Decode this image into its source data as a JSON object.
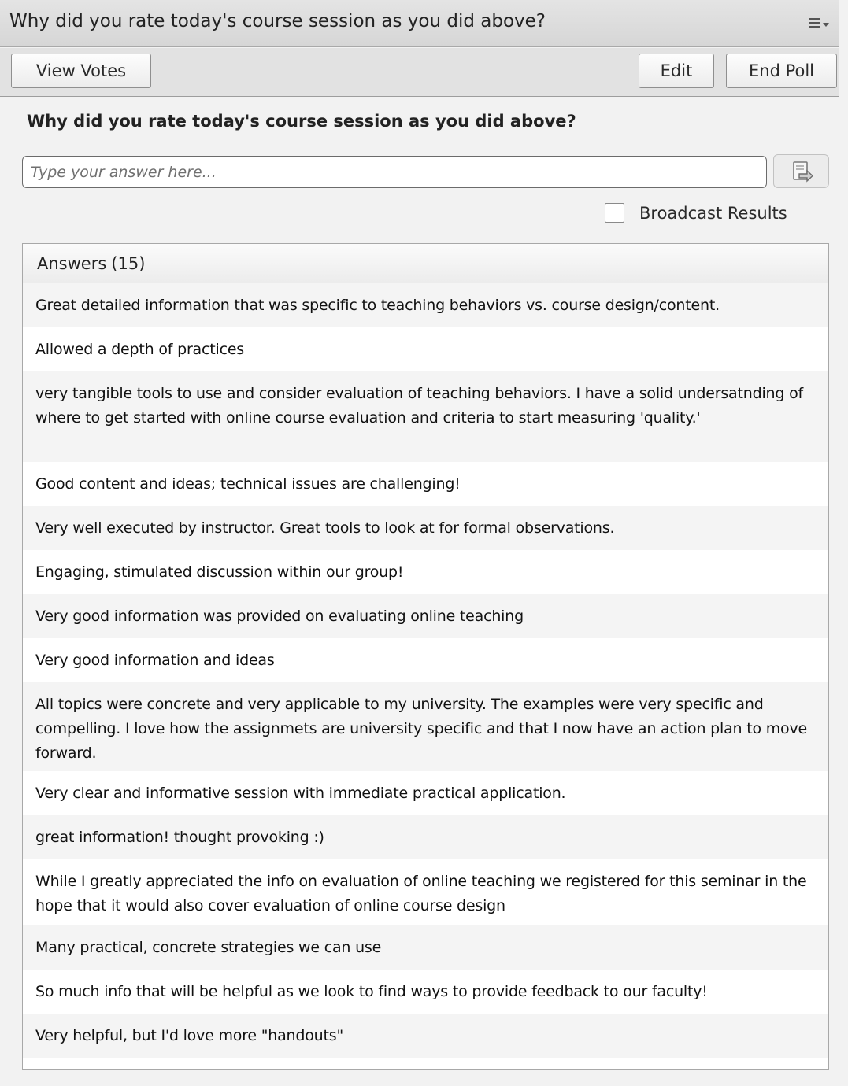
{
  "pod": {
    "title": "Why did you rate today's course session as you did above?",
    "menu_icon": "pod-options-menu-icon"
  },
  "toolbar": {
    "view_votes_label": "View Votes",
    "edit_label": "Edit",
    "end_poll_label": "End Poll"
  },
  "question": "Why did you rate today's course session as you did above?",
  "answer_input": {
    "value": "",
    "placeholder": "Type your answer here..."
  },
  "submit_icon": "submit-answer-icon",
  "broadcast": {
    "label": "Broadcast Results",
    "checked": false
  },
  "answers": {
    "header_label": "Answers",
    "count": "(15)",
    "items": [
      "Great detailed information that was specific to teaching behaviors vs. course design/content.",
      "Allowed a depth of practices",
      "very tangible tools to use and consider evaluation of teaching behaviors.  I have a solid undersatnding of where to get started with online course evaluation and criteria to start measuring 'quality.'",
      "Good content and ideas; technical issues are challenging!",
      "Very well executed by instructor. Great tools to look at for formal observations.",
      "Engaging, stimulated discussion within our group!",
      "Very good information was provided on evaluating online teaching",
      "Very good information and ideas",
      "All topics were concrete and very applicable to my university. The examples were very specific and compelling. I love how the assignmets are university specific and that I now have an action plan to move forward.",
      "Very clear and informative session with immediate practical application.",
      "great information!  thought provoking :)",
      "While I greatly appreciated the info on evaluation of online teaching we registered for this seminar in the hope that it would also cover evaluation of online course design",
      "Many practical, concrete strategies we can use",
      "So much info that will be helpful as we look to find ways to provide feedback to our faculty!",
      "Very helpful, but I'd love more \"handouts\""
    ]
  }
}
